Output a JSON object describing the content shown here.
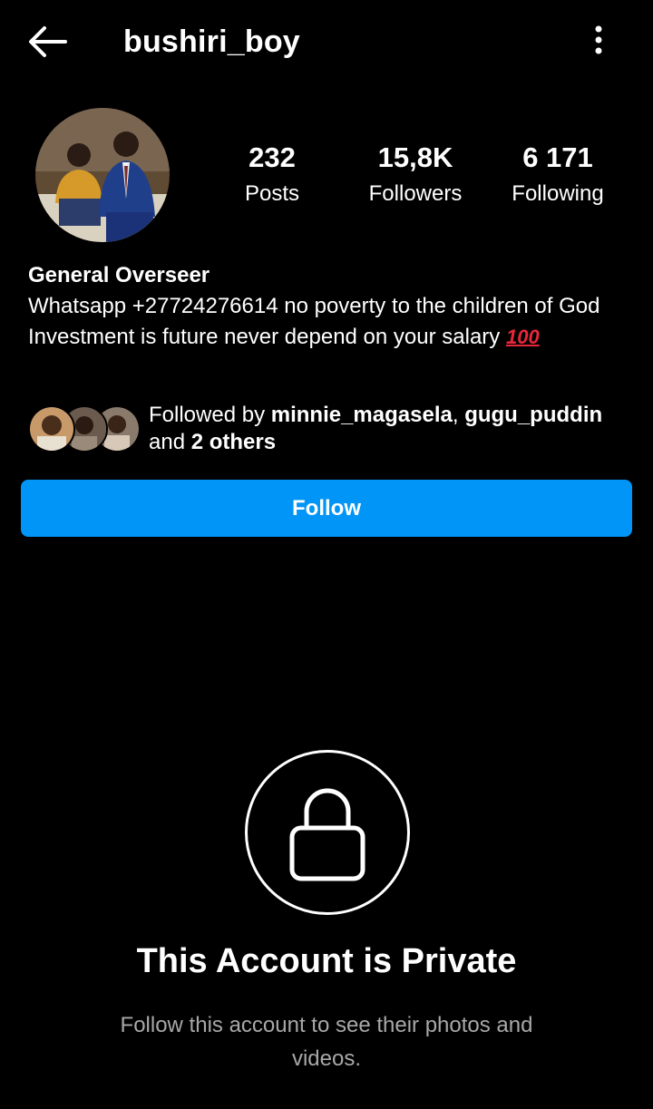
{
  "header": {
    "username": "bushiri_boy",
    "back_icon": "arrow-left-icon",
    "more_icon": "more-vertical-icon"
  },
  "stats": {
    "posts": {
      "count": "232",
      "label": "Posts"
    },
    "followers": {
      "count": "15,8K",
      "label": "Followers"
    },
    "following": {
      "count": "6 171",
      "label": "Following"
    }
  },
  "bio": {
    "name": "General Overseer",
    "line1": "Whatsapp +27724276614 no poverty to the children of God",
    "line2": "Investment is future never depend on your salary",
    "emoji": "100"
  },
  "mutuals": {
    "prefix": "Followed by ",
    "user1": "minnie_magasela",
    "separator": ", ",
    "user2": "gugu_puddin",
    "and": " and ",
    "others": "2 others"
  },
  "follow_button": {
    "label": "Follow"
  },
  "private": {
    "title": "This Account is Private",
    "subtitle": "Follow this account to see their photos and videos."
  },
  "colors": {
    "background": "#000000",
    "accent": "#0095f6",
    "secondary_text": "#a8a8a8",
    "emoji_red": "#e8263a"
  }
}
